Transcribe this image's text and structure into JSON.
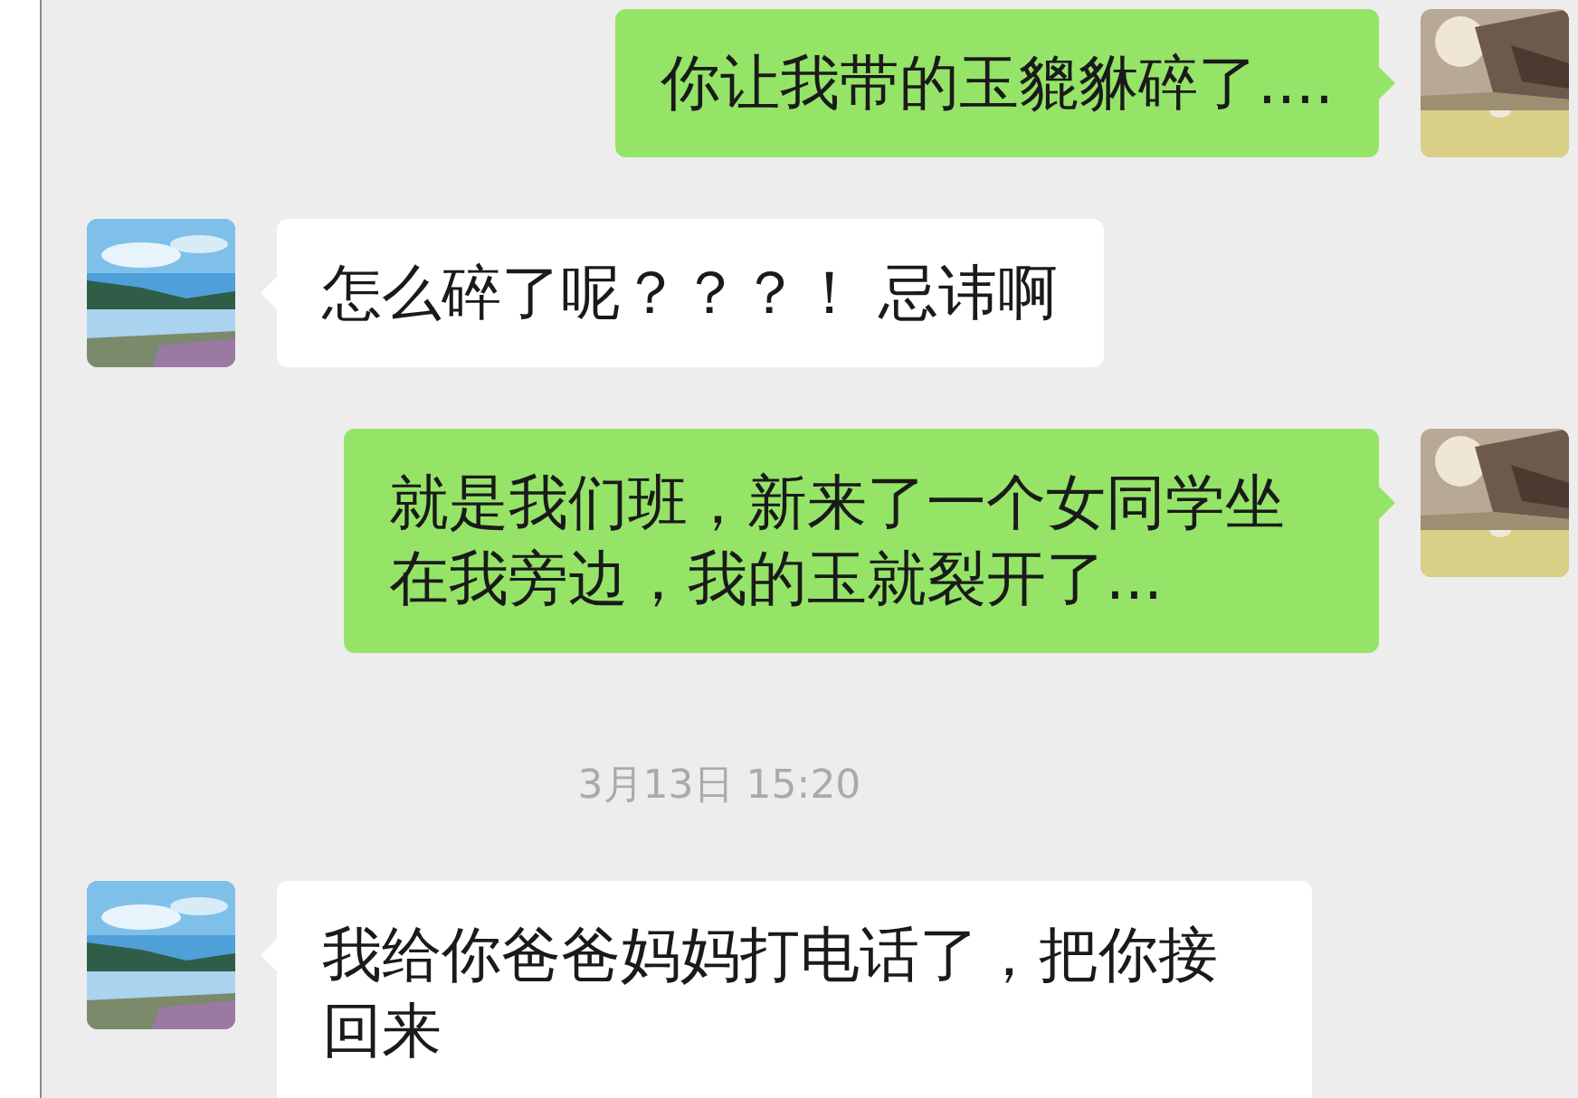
{
  "messages": [
    {
      "kind": "sent",
      "text": "你让我带的玉貔貅碎了...."
    },
    {
      "kind": "received",
      "text": "怎么碎了呢？？？！ 忌讳啊"
    },
    {
      "kind": "sent",
      "text": "就是我们班，新来了一个女同学坐在我旁边，我的玉就裂开了..."
    },
    {
      "kind": "time",
      "text": "3月13日 15:20"
    },
    {
      "kind": "received",
      "text": "我给你爸爸妈妈打电话了，把你接回来"
    }
  ]
}
